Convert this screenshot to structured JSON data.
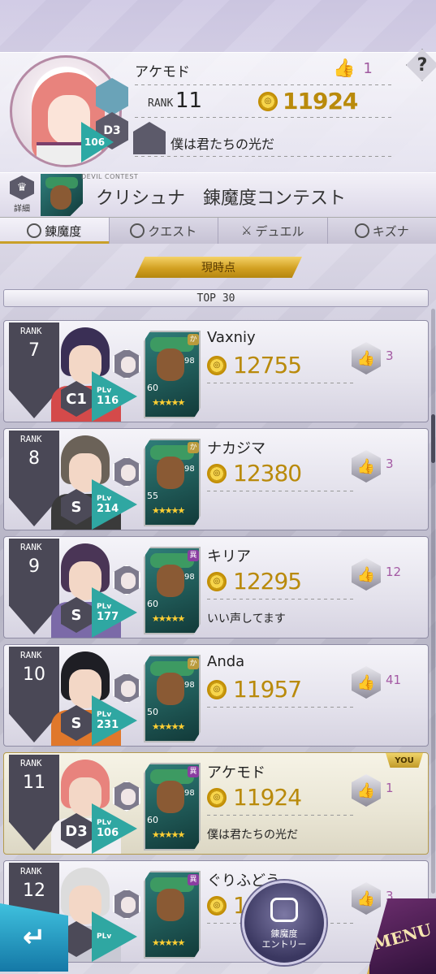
{
  "player": {
    "name": "アケモド",
    "rank_label": "RANK",
    "rank": "11",
    "score": "11924",
    "likes": "1",
    "rank_letter": "D3",
    "plv_label": "PLv",
    "plv": "106",
    "comment": "僕は君たちの光だ"
  },
  "help": {
    "label": "?"
  },
  "contest": {
    "detail_label": "詳細",
    "subtitle": "DEVIL CONTEST",
    "title": "クリシュナ　錬魔度コンテスト"
  },
  "tabs": [
    {
      "label": "錬魔度",
      "active": true
    },
    {
      "label": "クエスト",
      "active": false
    },
    {
      "label": "デュエル",
      "active": false
    },
    {
      "label": "キズナ",
      "active": false
    }
  ],
  "now_button": "現時点",
  "top_label": "TOP 30",
  "rank_label": "RANK",
  "plv_label": "PLv",
  "rows": [
    {
      "rank": "7",
      "name": "Vaxniy",
      "score": "12755",
      "likes": "3",
      "comment": "",
      "rank_letter": "C1",
      "plv": "116",
      "devil_lv": "60",
      "devil_lv2": "98",
      "attr": "か",
      "you": false
    },
    {
      "rank": "8",
      "name": "ナカジマ",
      "score": "12380",
      "likes": "3",
      "comment": "",
      "rank_letter": "S",
      "plv": "214",
      "devil_lv": "55",
      "devil_lv2": "98",
      "attr": "か",
      "you": false
    },
    {
      "rank": "9",
      "name": "キリア",
      "score": "12295",
      "likes": "12",
      "comment": "いい声してます",
      "rank_letter": "S",
      "plv": "177",
      "devil_lv": "60",
      "devil_lv2": "98",
      "attr": "異",
      "you": false
    },
    {
      "rank": "10",
      "name": "Anda",
      "score": "11957",
      "likes": "41",
      "comment": "",
      "rank_letter": "S",
      "plv": "231",
      "devil_lv": "50",
      "devil_lv2": "98",
      "attr": "か",
      "you": false
    },
    {
      "rank": "11",
      "name": "アケモド",
      "score": "11924",
      "likes": "1",
      "comment": "僕は君たちの光だ",
      "rank_letter": "D3",
      "plv": "106",
      "devil_lv": "60",
      "devil_lv2": "98",
      "attr": "異",
      "you": true
    },
    {
      "rank": "12",
      "name": "ぐりふどう",
      "score": "1",
      "likes": "3",
      "comment": "",
      "rank_letter": "",
      "plv": "",
      "devil_lv": "",
      "devil_lv2": "",
      "attr": "異",
      "you": false
    }
  ],
  "you_badge": "YOU",
  "entry_button": {
    "line1": "錬魔度",
    "line2": "エントリー"
  },
  "menu_button": "MENU",
  "back_icon": "back-arrow-icon",
  "colors": {
    "gold": "#b98a0b",
    "teal": "#2fa7a2",
    "like_pink": "#a45aa4",
    "tab_accent": "#c9a028"
  }
}
